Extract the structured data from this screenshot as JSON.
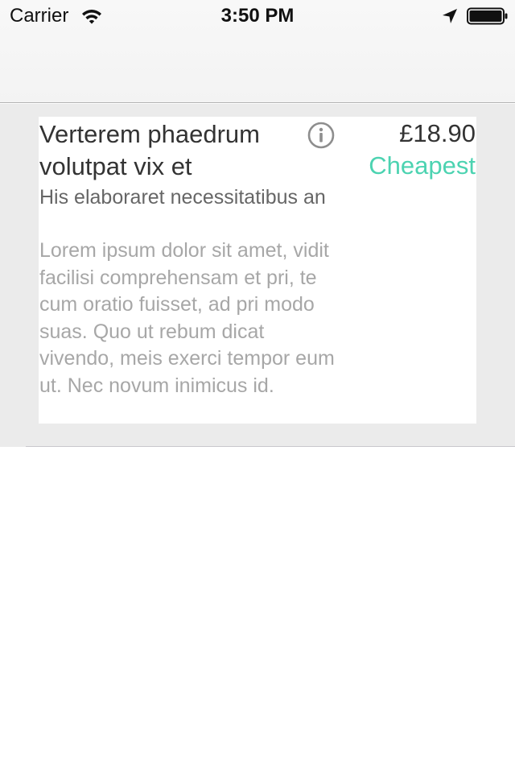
{
  "status_bar": {
    "carrier": "Carrier",
    "time": "3:50 PM",
    "icons": [
      "wifi-icon",
      "location-arrow-icon",
      "battery-icon"
    ]
  },
  "item": {
    "title": "Verterem phaedrum volutpat vix et",
    "subtitle": "His elaboraret necessitatibus an",
    "description": "Lorem ipsum dolor sit amet, vidit facilisi comprehensam et pri, te cum oratio fuisset, ad pri modo suas. Quo ut rebum dicat vivendo, meis exerci tempor eum ut. Nec novum inimicus id.",
    "price": "£18.90",
    "tag": "Cheapest",
    "info_icon": "info-icon"
  },
  "colors": {
    "tag": "#4cd3b1",
    "title": "#333333",
    "subtitle": "#666666",
    "description": "#a7a7a7",
    "list_background": "#ebebeb",
    "nav_background": "#f6f6f6"
  }
}
